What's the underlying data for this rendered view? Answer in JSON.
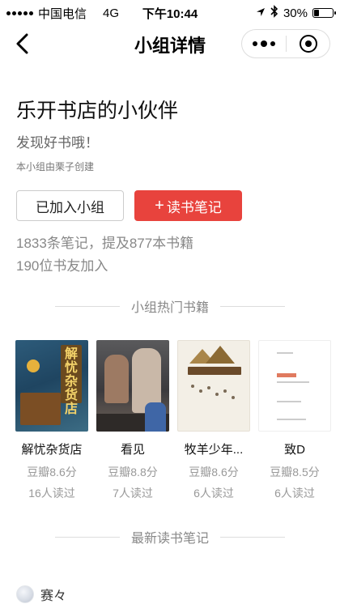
{
  "status_bar": {
    "carrier": "中国电信",
    "network": "4G",
    "time": "下午10:44",
    "battery": "30%",
    "battery_level": 0.3
  },
  "nav": {
    "title": "小组详情"
  },
  "group": {
    "title": "乐开书店的小伙伴",
    "description": "发现好书哦！",
    "creator": "本小组由栗子创建",
    "joined_button": "已加入小组",
    "note_button": "读书笔记",
    "stats_notes": "1833条笔记，提及877本书籍",
    "stats_members": "190位书友加入"
  },
  "hot_books": {
    "heading": "小组热门书籍",
    "items": [
      {
        "name": "解忧杂货店",
        "rating": "豆瓣8.6分",
        "readers": "16人读过",
        "cover_text": "解忧杂货店"
      },
      {
        "name": "看见",
        "rating": "豆瓣8.8分",
        "readers": "7人读过"
      },
      {
        "name": "牧羊少年...",
        "rating": "豆瓣8.6分",
        "readers": "6人读过"
      },
      {
        "name": "致D",
        "rating": "豆瓣8.5分",
        "readers": "6人读过"
      }
    ]
  },
  "latest_notes": {
    "heading": "最新读书笔记",
    "first_user": "赛々"
  }
}
